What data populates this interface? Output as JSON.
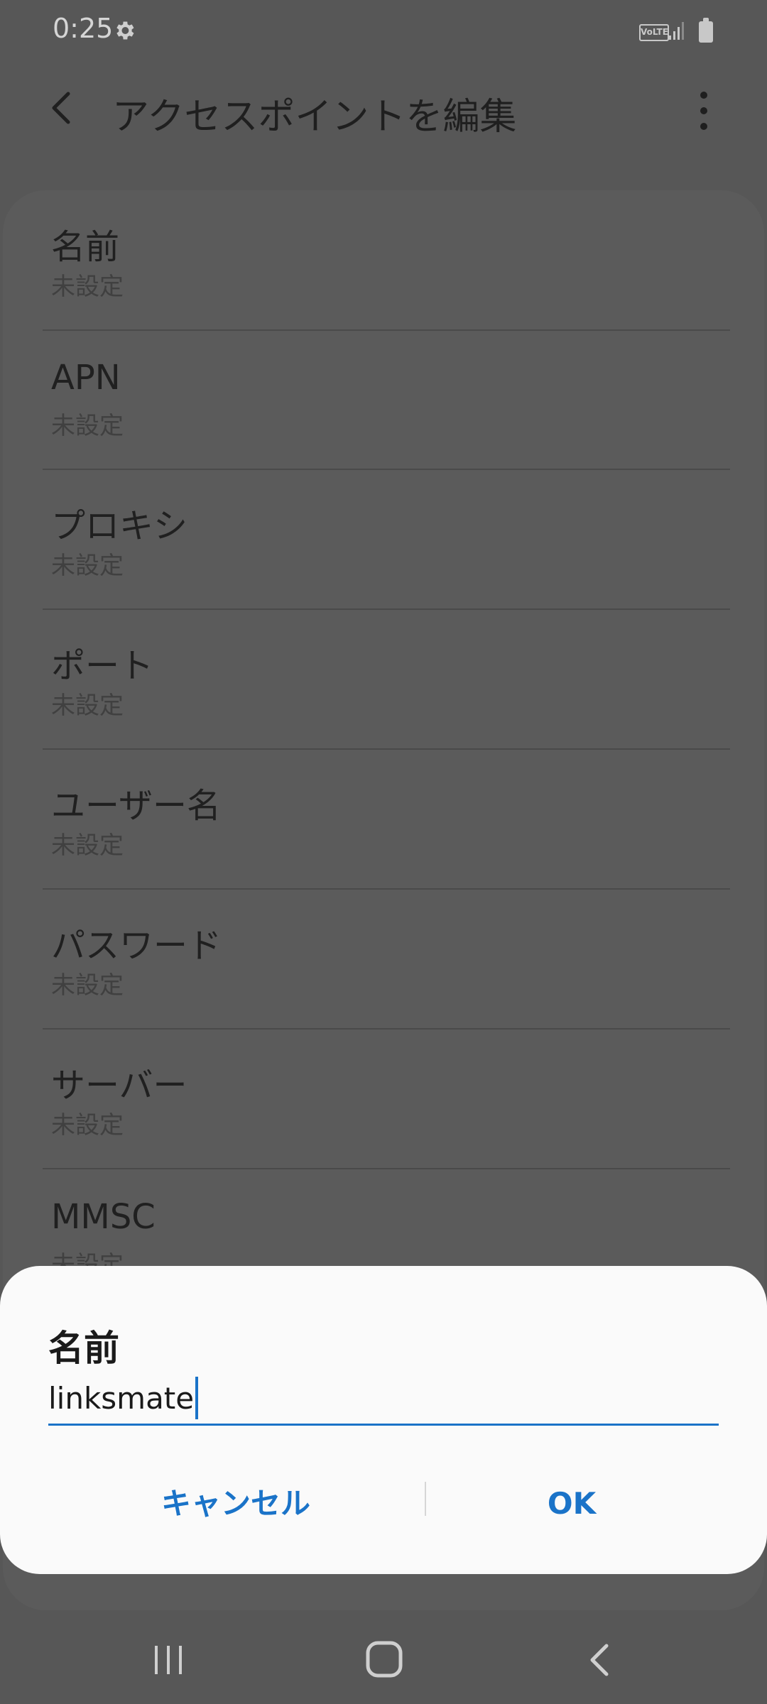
{
  "status_bar": {
    "time": "0:25",
    "volte_label": "VoLTE"
  },
  "app_bar": {
    "title": "アクセスポイントを編集"
  },
  "settings_list": [
    {
      "title": "名前",
      "value": "未設定"
    },
    {
      "title": "APN",
      "value": "未設定"
    },
    {
      "title": "プロキシ",
      "value": "未設定"
    },
    {
      "title": "ポート",
      "value": "未設定"
    },
    {
      "title": "ユーザー名",
      "value": "未設定"
    },
    {
      "title": "パスワード",
      "value": "未設定"
    },
    {
      "title": "サーバー",
      "value": "未設定"
    },
    {
      "title": "MMSC",
      "value": "未設定"
    }
  ],
  "dialog": {
    "title": "名前",
    "input_value": "linksmate",
    "cancel_label": "キャンセル",
    "ok_label": "OK"
  },
  "colors": {
    "accent": "#1a73c8",
    "dim_background": "#575757",
    "dialog_background": "#fafafa"
  },
  "icons": [
    "settings-gear-icon",
    "signal-icon",
    "battery-icon",
    "back-arrow-icon",
    "more-vert-icon",
    "nav-recent-icon",
    "nav-home-icon",
    "nav-back-icon"
  ]
}
